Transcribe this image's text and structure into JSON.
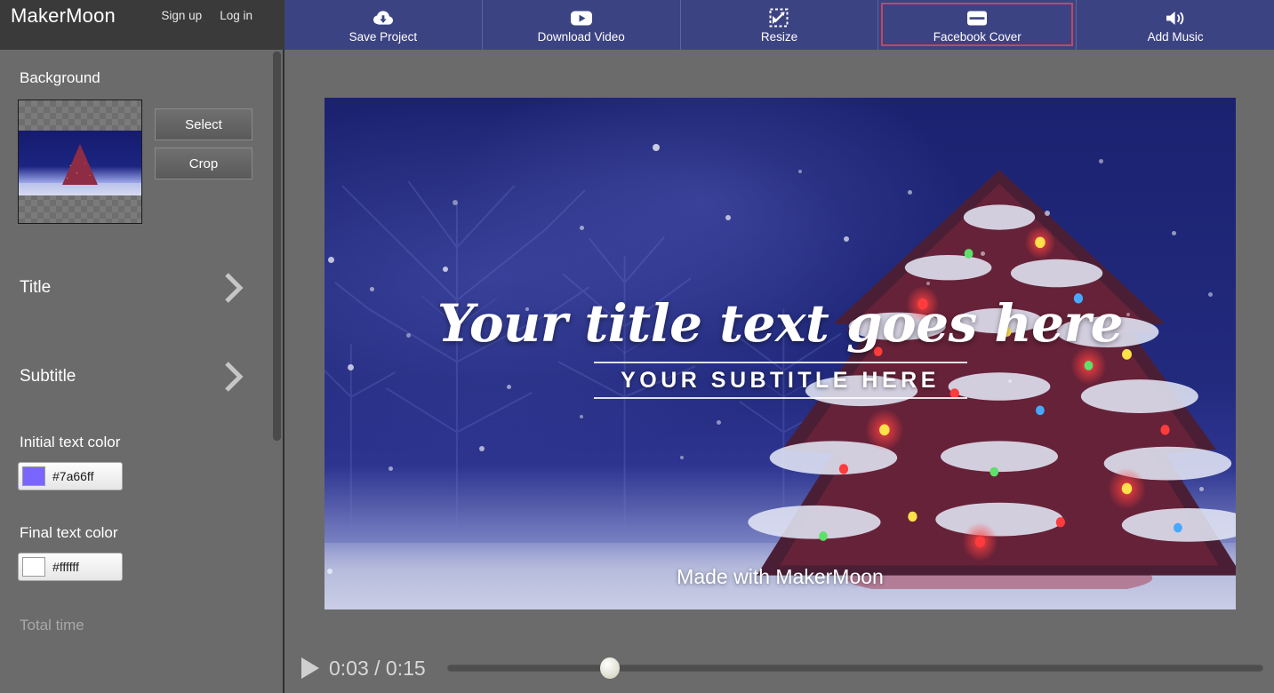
{
  "brand": {
    "logo": "MakerMoon",
    "signup": "Sign up",
    "login": "Log in"
  },
  "toolbar": {
    "items": [
      {
        "label": "Save Project",
        "icon": "cloud-download-icon",
        "selected": false
      },
      {
        "label": "Download Video",
        "icon": "youtube-play-icon",
        "selected": false
      },
      {
        "label": "Resize",
        "icon": "resize-arrow-icon",
        "selected": false
      },
      {
        "label": "Facebook Cover",
        "icon": "cover-layout-icon",
        "selected": true
      },
      {
        "label": "Add Music",
        "icon": "speaker-volume-icon",
        "selected": false
      }
    ],
    "selected_highlight_color": "#c0495e",
    "background_color": "#3c4382"
  },
  "sidebar": {
    "background_section": {
      "heading": "Background",
      "select_button": "Select",
      "crop_button": "Crop"
    },
    "nav_rows": [
      {
        "label": "Title"
      },
      {
        "label": "Subtitle"
      }
    ],
    "initial_text_color": {
      "label": "Initial text color",
      "value": "#7a66ff"
    },
    "final_text_color": {
      "label": "Final text color",
      "value": "#ffffff"
    },
    "total_time": {
      "label": "Total time"
    }
  },
  "canvas": {
    "title": "Your title text goes here",
    "subtitle": "YOUR SUBTITLE HERE",
    "watermark": "Made with MakerMoon"
  },
  "player": {
    "current_time": "0:03",
    "total_time": "0:15",
    "time_display": "0:03 / 0:15",
    "progress_percent": 20
  }
}
